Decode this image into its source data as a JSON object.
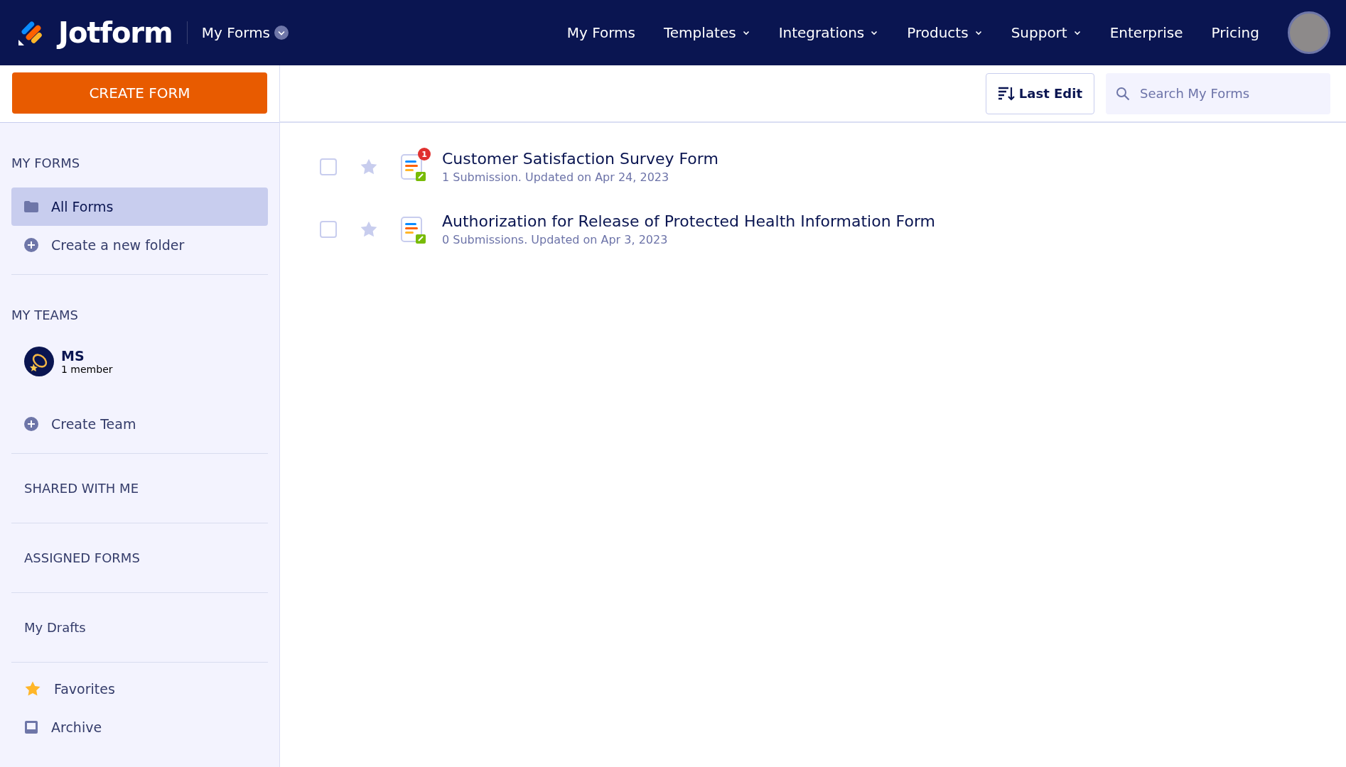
{
  "header": {
    "logo": "Jotform",
    "context_menu": "My Forms",
    "nav": [
      {
        "label": "My Forms",
        "has_dropdown": false
      },
      {
        "label": "Templates",
        "has_dropdown": true
      },
      {
        "label": "Integrations",
        "has_dropdown": true
      },
      {
        "label": "Products",
        "has_dropdown": true
      },
      {
        "label": "Support",
        "has_dropdown": true
      },
      {
        "label": "Enterprise",
        "has_dropdown": false
      },
      {
        "label": "Pricing",
        "has_dropdown": false
      }
    ]
  },
  "sidebar": {
    "create_button": "CREATE FORM",
    "my_forms": {
      "heading": "MY FORMS",
      "items": [
        {
          "label": "All Forms",
          "kind": "folder",
          "selected": true
        },
        {
          "label": "Create a new folder",
          "kind": "add",
          "selected": false
        }
      ]
    },
    "my_teams": {
      "heading": "MY TEAMS",
      "team": {
        "name": "MS",
        "members": "1 member"
      },
      "create": "Create Team"
    },
    "sections": [
      "SHARED WITH ME",
      "ASSIGNED FORMS",
      "My Drafts"
    ],
    "bottom_items": [
      {
        "label": "Favorites",
        "kind": "star"
      },
      {
        "label": "Archive",
        "kind": "archive"
      }
    ]
  },
  "toolbar": {
    "sort_button": "Last Edit",
    "search": {
      "placeholder": "Search My Forms"
    }
  },
  "forms": [
    {
      "title": "Customer Satisfaction Survey Form",
      "meta": "1 Submission. Updated on Apr 24, 2023",
      "badge": "1",
      "checked": false,
      "starred": false
    },
    {
      "title": "Authorization for Release of Protected Health Information Form",
      "meta": "0 Submissions. Updated on Apr 3, 2023",
      "checked": false,
      "starred": false
    }
  ]
}
